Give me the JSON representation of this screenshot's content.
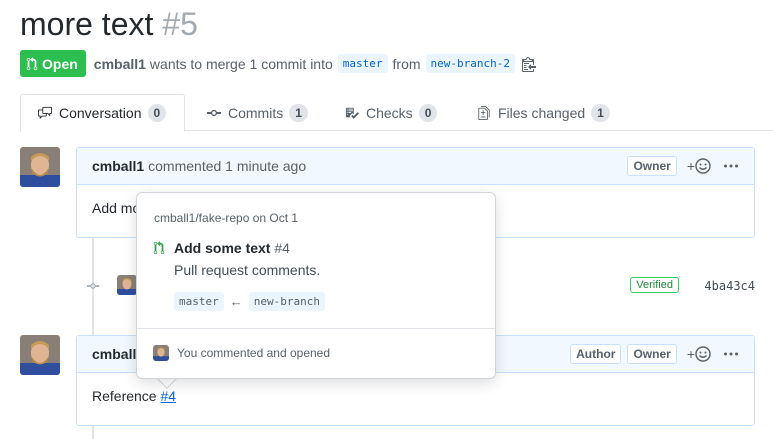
{
  "pr": {
    "title": "more text",
    "number": "#5",
    "state": "Open",
    "author": "cmball1",
    "merge_text": "wants to merge 1 commit into",
    "base_branch": "master",
    "from_text": "from",
    "head_branch": "new-branch-2"
  },
  "tabs": [
    {
      "label": "Conversation",
      "count": "0",
      "icon": "comment-discussion-icon"
    },
    {
      "label": "Commits",
      "count": "1",
      "icon": "git-commit-icon"
    },
    {
      "label": "Checks",
      "count": "0",
      "icon": "checklist-icon"
    },
    {
      "label": "Files changed",
      "count": "1",
      "icon": "file-diff-icon"
    }
  ],
  "comment1": {
    "author": "cmball1",
    "action": "commented 1 minute ago",
    "owner_label": "Owner",
    "body": "Add mo"
  },
  "commit": {
    "verified": "Verified",
    "sha": "4ba43c4"
  },
  "comment2": {
    "author": "cmball",
    "author_label": "Author",
    "owner_label": "Owner",
    "body_prefix": "Reference",
    "body_link": "#4"
  },
  "popover": {
    "repo": "cmball1/fake-repo",
    "date": "on Oct 1",
    "title": "Add some text",
    "number": "#4",
    "description": "Pull request comments.",
    "base_branch": "master",
    "arrow": "←",
    "head_branch": "new-branch",
    "footer": "You commented and opened"
  },
  "colors": {
    "open_green": "#2cbe4e",
    "link_blue": "#0366d6",
    "comment_border": "#c8e1ff",
    "comment_header_bg": "#f1f8ff"
  }
}
